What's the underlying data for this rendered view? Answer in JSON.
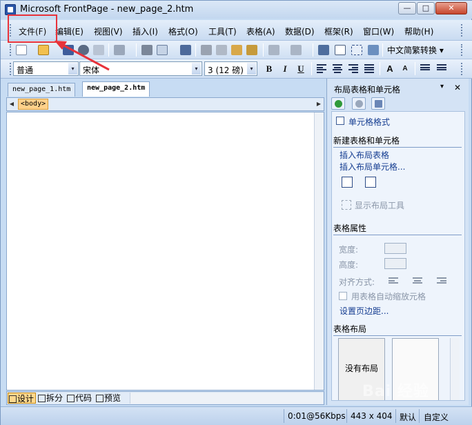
{
  "window": {
    "title": "Microsoft FrontPage - new_page_2.htm",
    "minimize_glyph": "—",
    "maximize_glyph": "□",
    "close_glyph": "✕"
  },
  "menu": [
    {
      "label": "文件(F)"
    },
    {
      "label": "编辑(E)"
    },
    {
      "label": "视图(V)"
    },
    {
      "label": "插入(I)"
    },
    {
      "label": "格式(O)"
    },
    {
      "label": "工具(T)"
    },
    {
      "label": "表格(A)"
    },
    {
      "label": "数据(D)"
    },
    {
      "label": "框架(R)"
    },
    {
      "label": "窗口(W)"
    },
    {
      "label": "帮助(H)"
    }
  ],
  "toolbar": {
    "convert_label": "中文简繁转换 ▾"
  },
  "format_bar": {
    "style_value": "普通",
    "font_value": "宋体",
    "size_value": "3 (12 磅)",
    "bold": "B",
    "italic": "I",
    "underline": "U",
    "grow_font": "A",
    "shrink_font": "A"
  },
  "tabs": [
    {
      "label": "new_page_1.htm",
      "active": false
    },
    {
      "label": "new_page_2.htm",
      "active": true
    }
  ],
  "tag_selector": {
    "left_arrow": "◀",
    "right_arrow": "▶",
    "tag": "<body>"
  },
  "view_modes": [
    {
      "label": "设计",
      "active": true
    },
    {
      "label": "拆分",
      "active": false
    },
    {
      "label": "代码",
      "active": false
    },
    {
      "label": "预览",
      "active": false
    }
  ],
  "task_pane": {
    "title": "布局表格和单元格",
    "close_glyph": "✕",
    "dropdown_glyph": "▾",
    "cell_format_link": "单元格格式",
    "new_section": "新建表格和单元格",
    "insert_table_link": "插入布局表格",
    "insert_cell_link": "插入布局单元格...",
    "show_tools": "显示布局工具",
    "props_section": "表格属性",
    "width_label": "宽度:",
    "height_label": "高度:",
    "align_label": "对齐方式:",
    "autoscale_label": "用表格自动缩放元格",
    "margins_link": "设置页边距...",
    "layout_section": "表格布局",
    "no_layout": "没有布局"
  },
  "status": {
    "speed": "0:01@56Kbps",
    "size": "443 x 404",
    "default": "默认",
    "custom": "自定义"
  },
  "watermark": "Bai 经验",
  "colors": {
    "highlight": "#e8323a",
    "link": "#153d91",
    "chrome": "#c7dcf3"
  }
}
